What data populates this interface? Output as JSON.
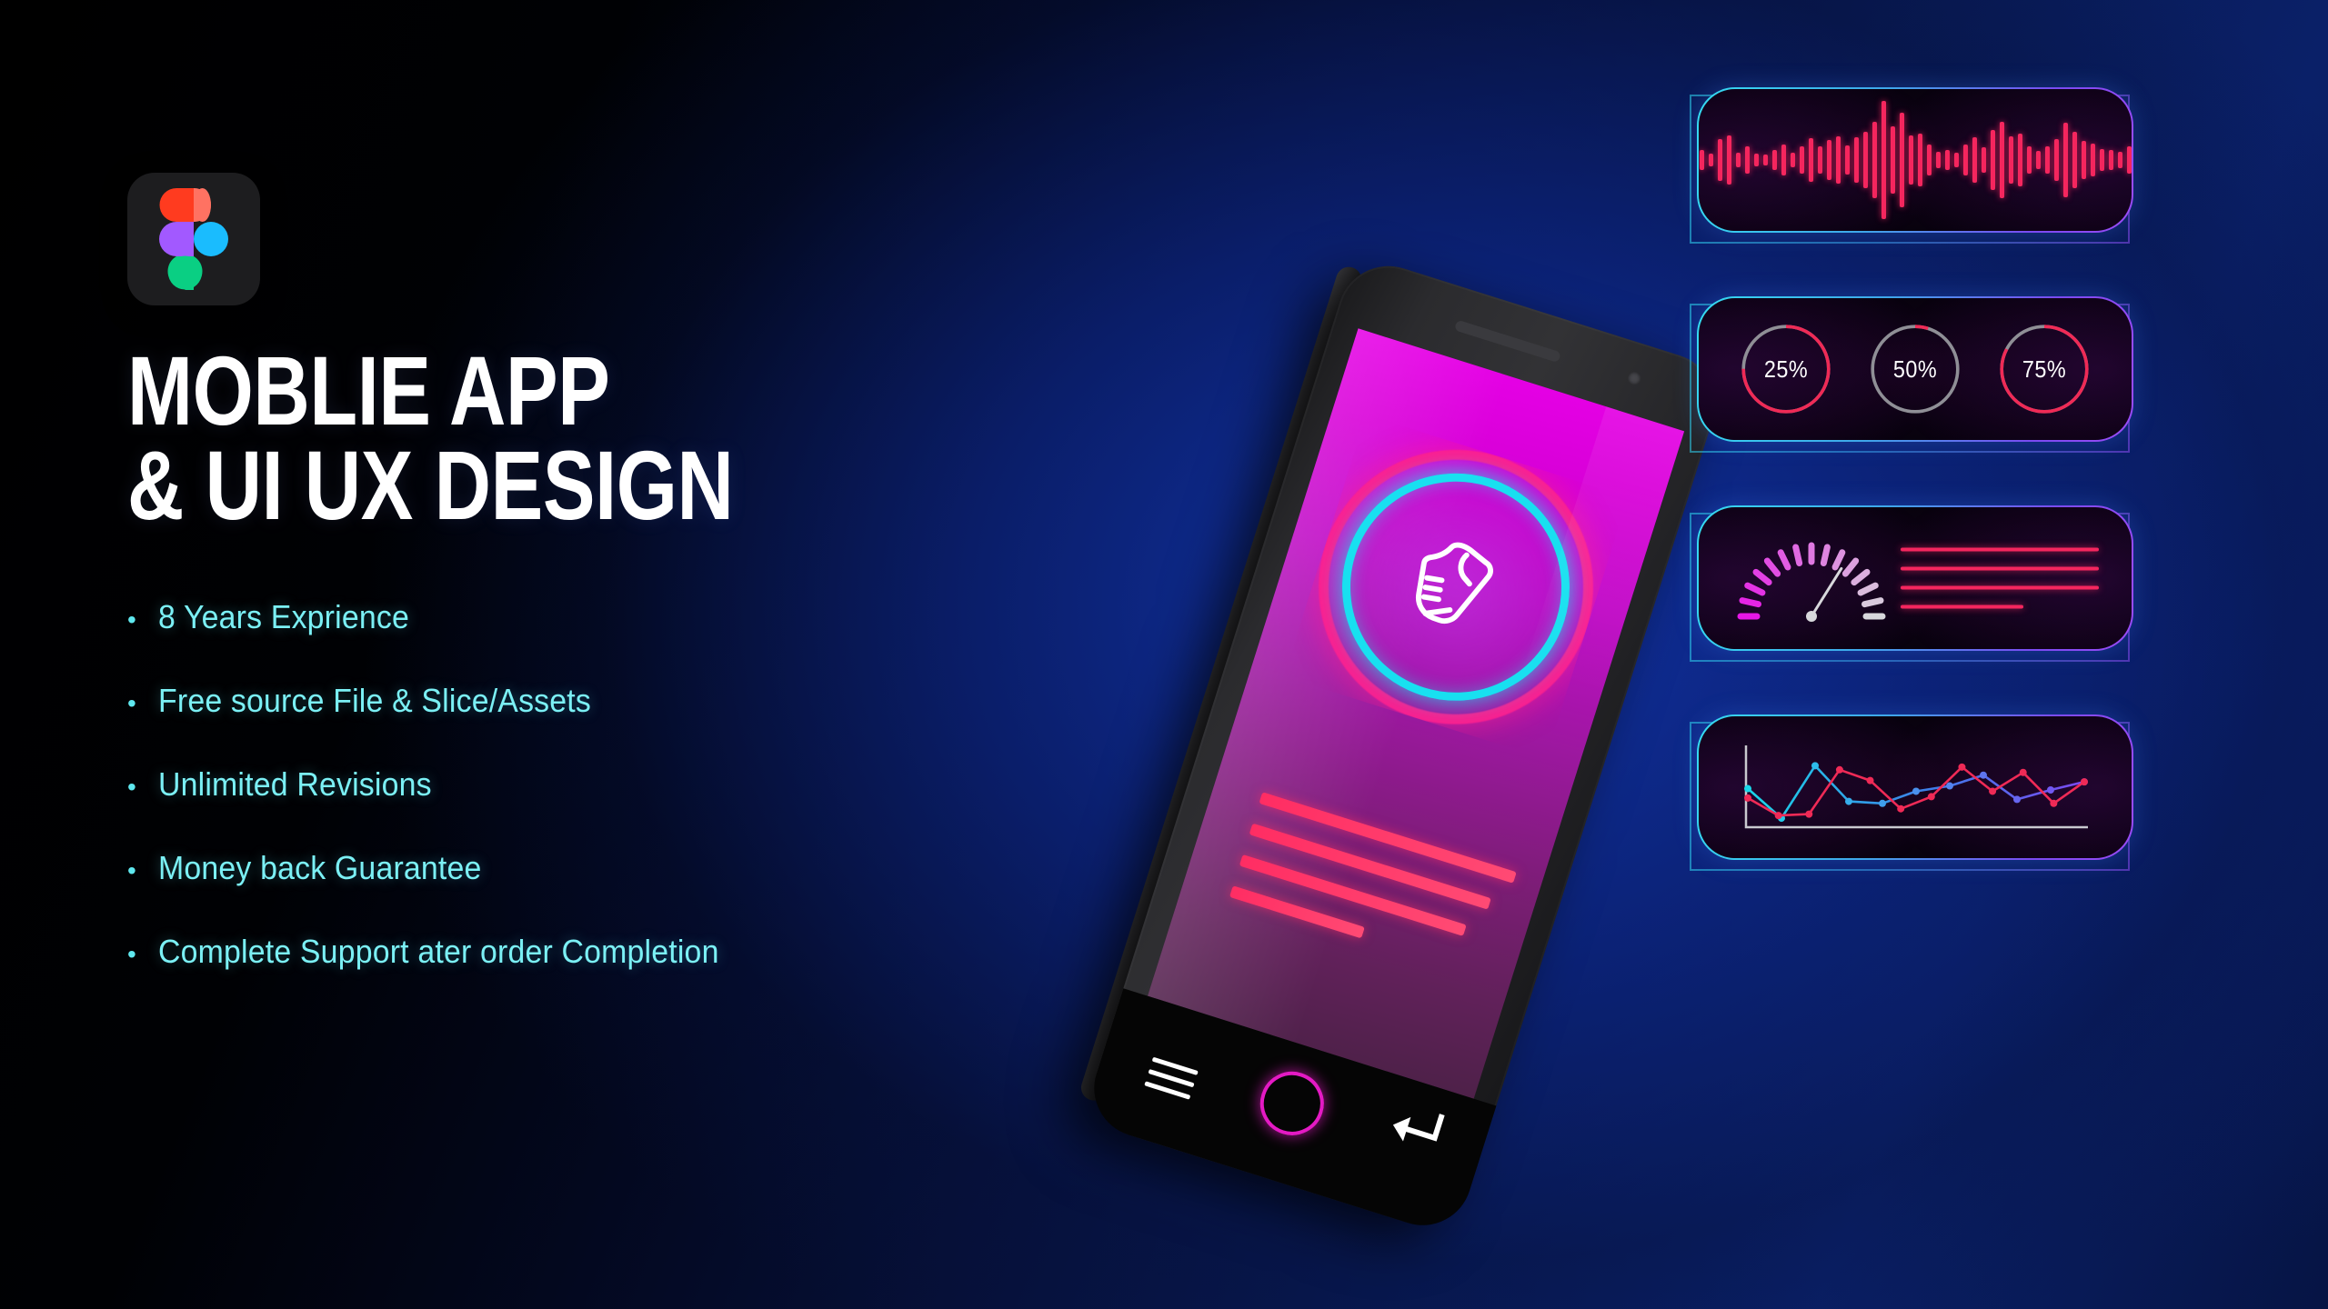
{
  "brand": {
    "logo_name": "figma-logo",
    "logo_colors": {
      "orange": "#ff3b1f",
      "salmon": "#ff7262",
      "purple": "#a259ff",
      "blue": "#1abcfe",
      "green": "#0acf83",
      "tile": "#1d1d1f"
    }
  },
  "headline": {
    "line1": "MOBLIE APP",
    "line2": "& UI UX DESIGN",
    "full": "MOBLIE APP\n& UI UX DESIGN",
    "color": "#ffffff"
  },
  "bullets": {
    "marker": "•",
    "color": "#7bf0f5",
    "items": [
      "8 Years Exprience",
      "Free source File & Slice/Assets",
      "Unlimited Revisions",
      "Money back Guarantee",
      "Complete Support ater order Completion"
    ]
  },
  "phone": {
    "screen_gradient": [
      "#e600e6",
      "#9c189f",
      "#4e2149"
    ],
    "app_icon": "sneaker-icon",
    "ring_cyan": "#18e0f0",
    "ring_pink": "#ff1f8f",
    "text_line_color": "#ff2d63",
    "text_line_widths": [
      "100%",
      "94%",
      "88%",
      "52%"
    ],
    "nav": {
      "menu_icon": "hamburger-menu-icon",
      "home_icon": "home-circle-icon",
      "back_icon": "back-arrow-icon",
      "home_color": "#e41ac4"
    }
  },
  "cards": {
    "border_gradient": [
      "#35dcf2",
      "#3fa6ea",
      "#9b4bf5"
    ],
    "accent": "#f5265e",
    "waveform": {
      "title": "audio-waveform-widget",
      "bar_color": "#f5265e",
      "bars": [
        22,
        14,
        46,
        54,
        16,
        30,
        14,
        12,
        22,
        34,
        16,
        30,
        48,
        30,
        44,
        52,
        32,
        50,
        62,
        84,
        130,
        74,
        104,
        54,
        58,
        34,
        18,
        22,
        16,
        34,
        50,
        28,
        66,
        84,
        52,
        58,
        30,
        20,
        30,
        46,
        82,
        62,
        42,
        36,
        24,
        22,
        18,
        30
      ]
    },
    "rings": {
      "title": "progress-rings-widget",
      "track_color": "#8f8f96",
      "items": [
        {
          "label": "25%",
          "value": 25,
          "arc_color": "#ef2a56"
        },
        {
          "label": "50%",
          "value": 50,
          "arc_color": "#ef2a56"
        },
        {
          "label": "75%",
          "value": 75,
          "arc_color": "#ef2a56"
        }
      ]
    },
    "gauge": {
      "title": "speedometer-widget",
      "tick_start_color": "#e617e6",
      "tick_end_color": "#d8d8dc",
      "needle_color": "#d8d8dc",
      "ticks": 15,
      "needle_angle_deg": 58,
      "lines": 4,
      "line_color": "#f5265e",
      "line_widths": [
        "100%",
        "100%",
        "100%",
        "62%"
      ]
    },
    "linechart": {
      "title": "line-chart-widget",
      "axis_color": "#c9c9cf",
      "series": [
        {
          "name": "series-cyan-purple",
          "color_start": "#19d8e8",
          "color_end": "#7b4af2",
          "values": [
            52,
            8,
            86,
            33,
            30,
            48,
            56,
            72,
            36,
            50,
            62
          ]
        },
        {
          "name": "series-red",
          "color": "#ef2a56",
          "values": [
            38,
            12,
            14,
            80,
            64,
            22,
            40,
            84,
            48,
            76,
            30,
            62
          ]
        }
      ],
      "ylim": [
        0,
        100
      ]
    }
  }
}
